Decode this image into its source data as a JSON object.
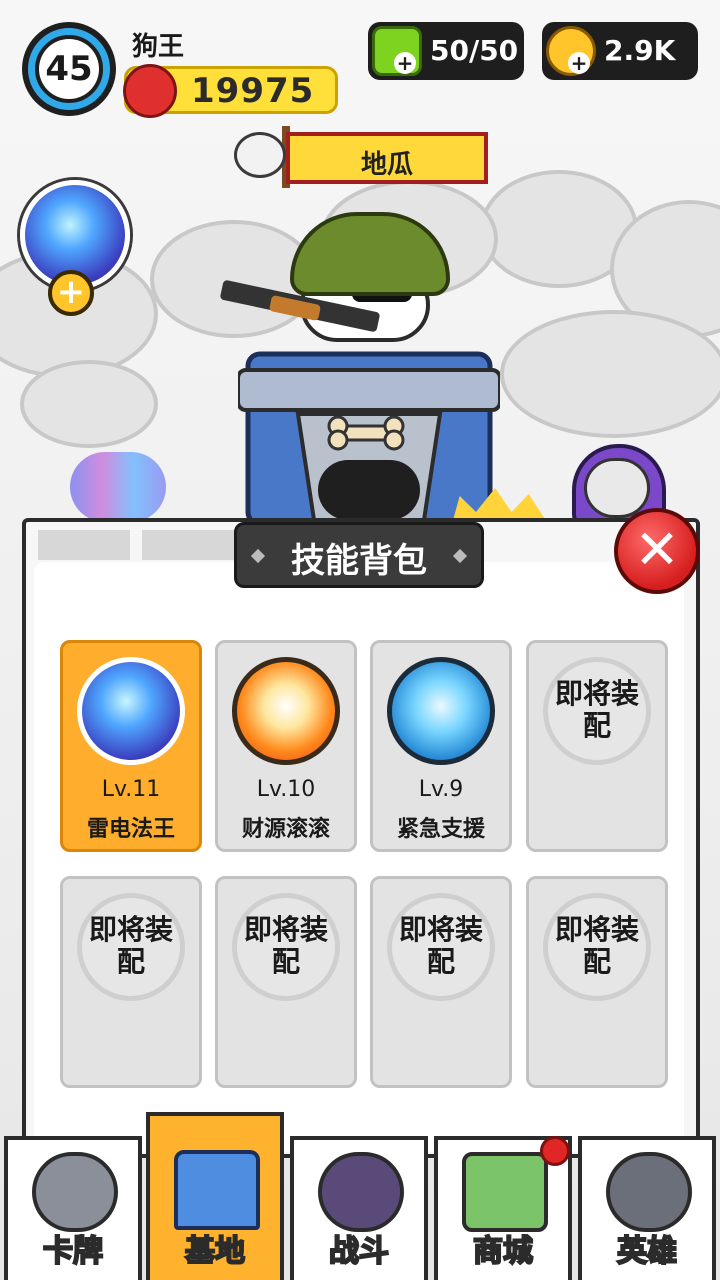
{
  "player": {
    "level": "45",
    "name": "狗王",
    "power": "19975"
  },
  "resources": {
    "energy": "50/50",
    "coins": "2.9K"
  },
  "banner": {
    "title": "地瓜"
  },
  "panel": {
    "title": "技能背包",
    "skills": [
      {
        "level": "Lv.11",
        "name": "雷电法王",
        "equipped": true,
        "icon": "lightning-orb-icon"
      },
      {
        "level": "Lv.10",
        "name": "财源滚滚",
        "equipped": false,
        "icon": "lucky-cat-icon"
      },
      {
        "level": "Lv.9",
        "name": "紧急支援",
        "equipped": false,
        "icon": "husky-support-icon"
      }
    ],
    "empty_label": "即将装配"
  },
  "nav": {
    "items": [
      {
        "label": "卡牌",
        "icon": "husky-head-icon"
      },
      {
        "label": "基地",
        "icon": "castle-icon"
      },
      {
        "label": "战斗",
        "icon": "paw-icon"
      },
      {
        "label": "商城",
        "icon": "cash-icon"
      },
      {
        "label": "英雄",
        "icon": "tophat-dog-icon"
      }
    ],
    "active": 1
  },
  "colors": {
    "accent": "#ffad2c",
    "close": "#d61e1e",
    "energy": "#7ed321",
    "coin": "#ffc52b"
  }
}
